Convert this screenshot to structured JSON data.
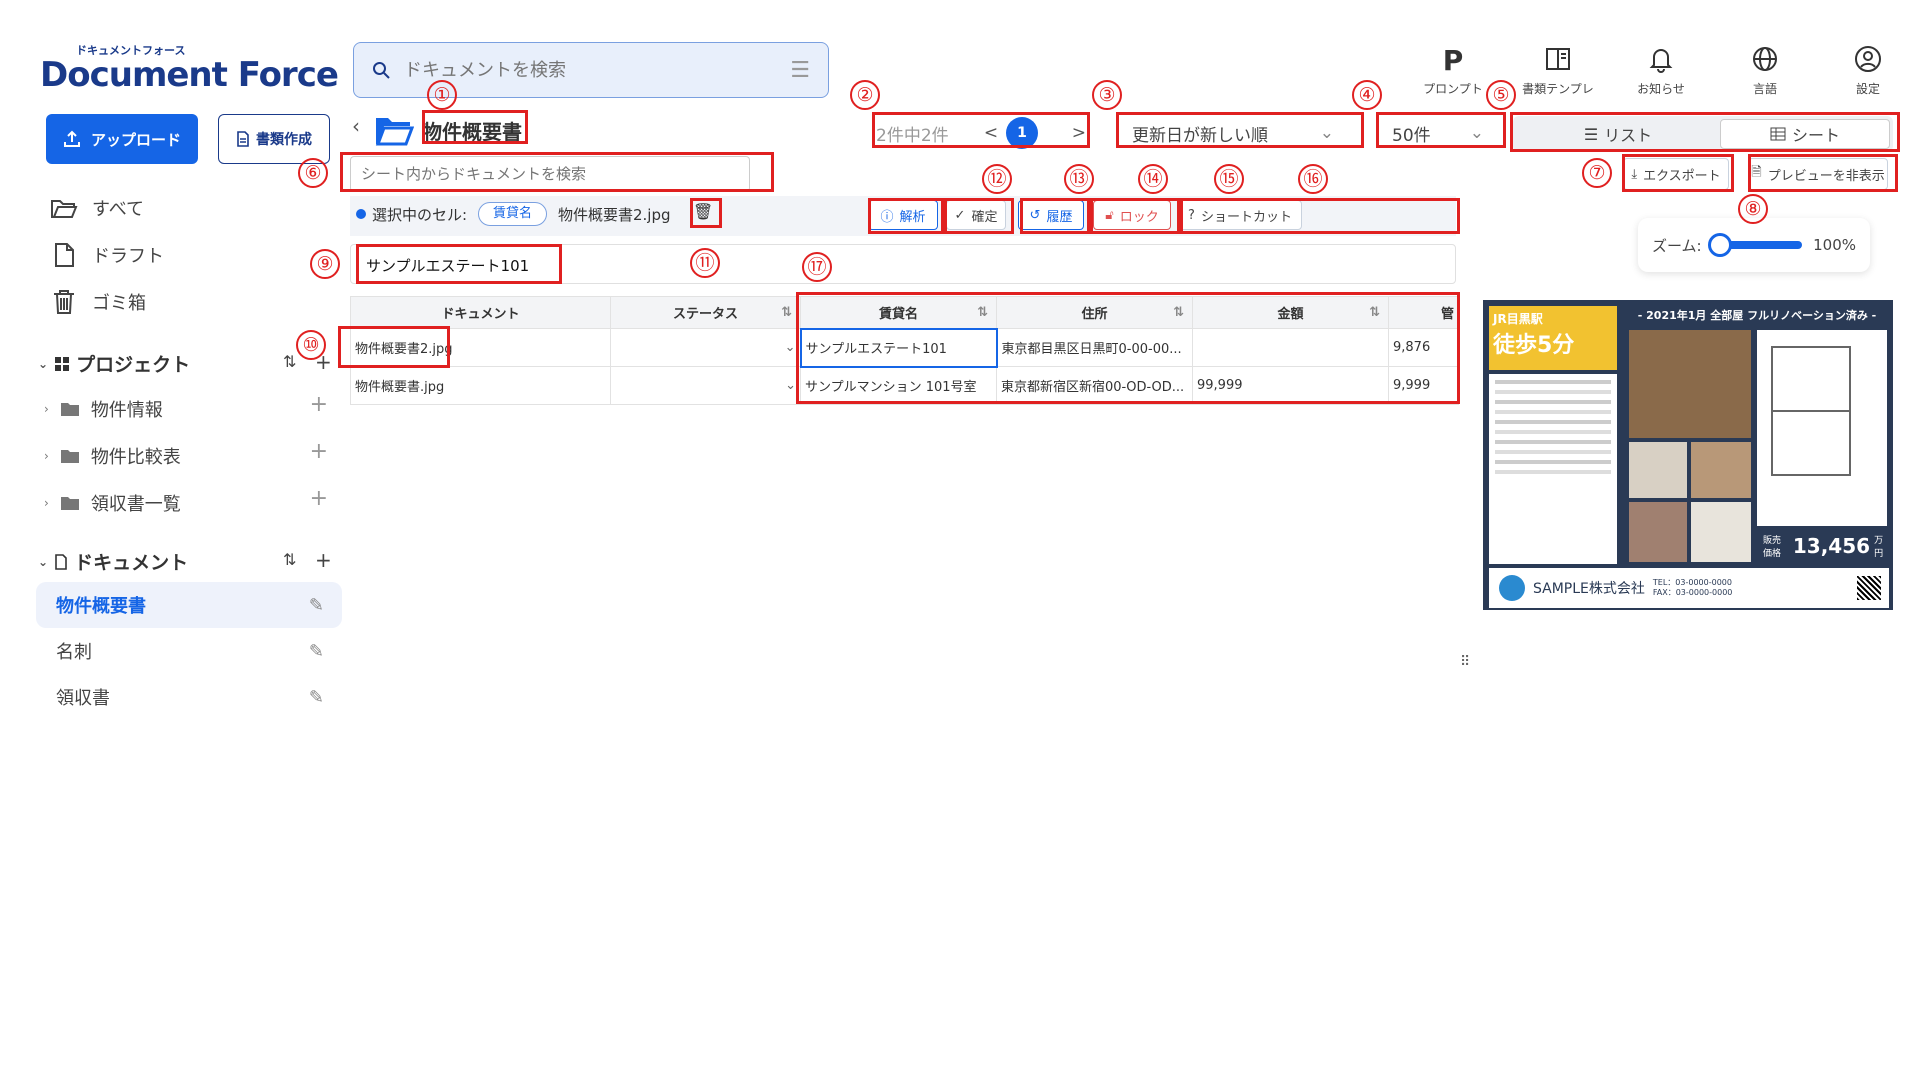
{
  "brand": {
    "small": "ドキュメントフォース",
    "logo": "Document Force"
  },
  "search": {
    "placeholder": "ドキュメントを検索"
  },
  "topnav": [
    {
      "label": "プロンプト",
      "icon": "p-icon"
    },
    {
      "label": "書類テンプレ",
      "icon": "book-icon"
    },
    {
      "label": "お知らせ",
      "icon": "bell-icon"
    },
    {
      "label": "言語",
      "icon": "globe-icon"
    },
    {
      "label": "設定",
      "icon": "user-icon"
    }
  ],
  "sidebar": {
    "upload": "アップロード",
    "create": "書類作成",
    "nav": [
      {
        "label": "すべて",
        "icon": "folder-open-icon"
      },
      {
        "label": "ドラフト",
        "icon": "file-icon"
      },
      {
        "label": "ゴミ箱",
        "icon": "trash-icon"
      }
    ],
    "project_title": "プロジェクト",
    "projects": [
      "物件情報",
      "物件比較表",
      "領収書一覧"
    ],
    "document_title": "ドキュメント",
    "documents": [
      "物件概要書",
      "名刺",
      "領収書"
    ]
  },
  "folder": {
    "title": "物件概要書"
  },
  "pagination": {
    "summary": "2件中2件",
    "prev": "<",
    "current": "1",
    "next": ">"
  },
  "sort": {
    "selected": "更新日が新しい順"
  },
  "perpage": {
    "selected": "50件"
  },
  "view": {
    "list": "リスト",
    "sheet": "シート"
  },
  "sheet_search": {
    "placeholder": "シート内からドキュメントを検索"
  },
  "actions": {
    "export": "エクスポート",
    "preview": "プレビューを非表示"
  },
  "zoom": {
    "label": "ズーム:",
    "value": "100%",
    "level": 0
  },
  "selection": {
    "label": "選択中のセル:",
    "field": "賃貸名",
    "file": "物件概要書2.jpg"
  },
  "tools": {
    "analyze": "解析",
    "confirm": "確定",
    "history": "履歴",
    "lock": "ロック",
    "shortcut": "ショートカット"
  },
  "cell_value": "サンプルエステート101",
  "table": {
    "headers": [
      "ドキュメント",
      "ステータス",
      "賃貸名",
      "住所",
      "金額",
      "管"
    ],
    "rows": [
      {
        "doc": "物件概要書2.jpg",
        "status": "",
        "name": "サンプルエステート101",
        "address": "東京都目黒区日黒町0-00-00...",
        "amount": "",
        "extra": "9,876"
      },
      {
        "doc": "物件概要書.jpg",
        "status": "",
        "name": "サンプルマンション 101号室",
        "address": "東京都新宿区新宿00-OD-OD...",
        "amount": "99,999",
        "extra": "9,999"
      }
    ]
  },
  "preview": {
    "station": "JR目黒駅",
    "walk": "徒歩5分",
    "headline": "- 2021年1月 全部屋 フルリノベーション済み -",
    "price_label": "販売価格",
    "price": "13,456",
    "price_unit": "万円",
    "company": "SAMPLE株式会社",
    "tel": "TEL：03-0000-0000",
    "fax": "FAX：03-0000-0000"
  },
  "callouts": [
    "①",
    "②",
    "③",
    "④",
    "⑤",
    "⑥",
    "⑦",
    "⑧",
    "⑨",
    "⑩",
    "⑪",
    "⑫",
    "⑬",
    "⑭",
    "⑮",
    "⑯",
    "⑰"
  ],
  "colors": {
    "accent": "#1565e6",
    "annot": "#e02020"
  }
}
